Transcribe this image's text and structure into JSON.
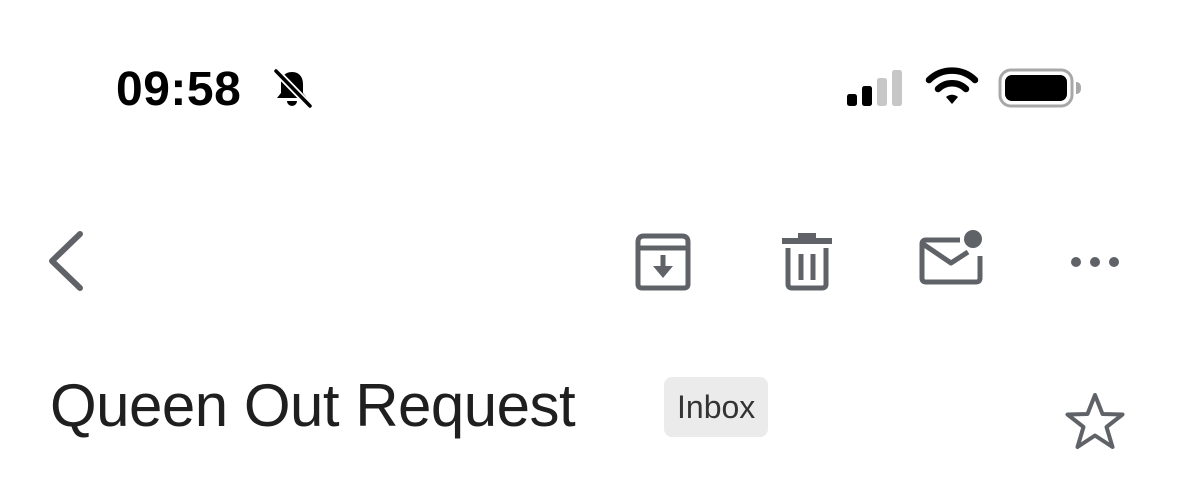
{
  "status_bar": {
    "time": "09:58",
    "icons": [
      "bell-slash-icon",
      "cellular-signal-icon",
      "wifi-icon",
      "battery-icon"
    ]
  },
  "toolbar": {
    "icons": [
      "chevron-left-icon",
      "archive-icon",
      "trash-icon",
      "mark-unread-icon",
      "more-horizontal-icon"
    ]
  },
  "email": {
    "subject": "Queen Out Request",
    "label": "Inbox",
    "star_icon": "star-outline-icon"
  },
  "colors": {
    "icon_gray": "#5f6368",
    "subject_text": "#1f1f1f",
    "chip_background": "#ebebeb",
    "signal_inactive": "#c7c7c7"
  }
}
